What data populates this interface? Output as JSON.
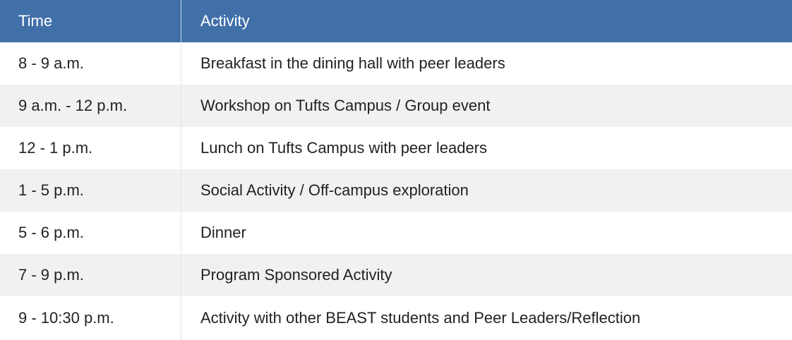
{
  "table": {
    "header": {
      "time": "Time",
      "activity": "Activity"
    },
    "rows": [
      {
        "time": "8 - 9 a.m.",
        "activity": "Breakfast in the dining hall with peer leaders"
      },
      {
        "time": "9 a.m. - 12 p.m.",
        "activity": "Workshop on Tufts Campus / Group event"
      },
      {
        "time": "12 - 1 p.m.",
        "activity": "Lunch on Tufts Campus with peer leaders"
      },
      {
        "time": "1 - 5 p.m.",
        "activity": "Social Activity / Off-campus exploration"
      },
      {
        "time": "5 - 6 p.m.",
        "activity": "Dinner"
      },
      {
        "time": "7 - 9 p.m.",
        "activity": "Program Sponsored Activity"
      },
      {
        "time": "9 - 10:30 p.m.",
        "activity": "Activity with other BEAST students and Peer Leaders/Reflection"
      }
    ]
  },
  "colors": {
    "header_background": "#4170a9",
    "header_text": "#ffffff",
    "row_alt_background": "#f1f1f1",
    "row_background": "#ffffff",
    "body_text": "#222222"
  }
}
